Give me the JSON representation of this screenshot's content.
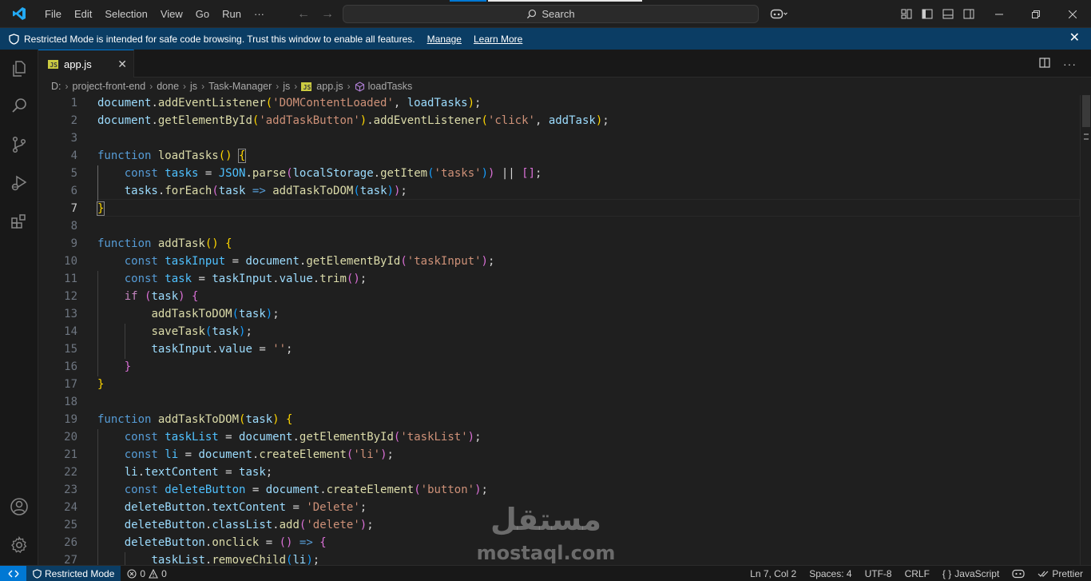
{
  "app": {
    "menu": [
      "File",
      "Edit",
      "Selection",
      "View",
      "Go",
      "Run",
      "···"
    ],
    "search_label": "Search",
    "accent_color": "#0078d4"
  },
  "banner": {
    "message": "Restricted Mode is intended for safe code browsing. Trust this window to enable all features.",
    "manage_label": "Manage",
    "learn_more_label": "Learn More"
  },
  "activity_icons": [
    "explorer-icon",
    "search-icon",
    "source-control-icon",
    "run-debug-icon",
    "extensions-icon",
    "accounts-icon",
    "manage-gear-icon"
  ],
  "editor": {
    "tab": {
      "label": "app.js",
      "badge": "JS"
    },
    "breadcrumb": [
      "D:",
      "project-front-end",
      "done",
      "js",
      "Task-Manager",
      "js",
      "app.js",
      "loadTasks"
    ],
    "active_line": 7,
    "lines": [
      [
        [
          "document",
          "vr"
        ],
        [
          ".",
          "op"
        ],
        [
          "addEventListener",
          "fn"
        ],
        [
          "(",
          "b1"
        ],
        [
          "'DOMContentLoaded'",
          "st"
        ],
        [
          ", ",
          "op"
        ],
        [
          "loadTasks",
          "vr"
        ],
        [
          ")",
          "b1"
        ],
        [
          ";",
          "op"
        ]
      ],
      [
        [
          "document",
          "vr"
        ],
        [
          ".",
          "op"
        ],
        [
          "getElementById",
          "fn"
        ],
        [
          "(",
          "b1"
        ],
        [
          "'addTaskButton'",
          "st"
        ],
        [
          ")",
          "b1"
        ],
        [
          ".",
          "op"
        ],
        [
          "addEventListener",
          "fn"
        ],
        [
          "(",
          "b1"
        ],
        [
          "'click'",
          "st"
        ],
        [
          ", ",
          "op"
        ],
        [
          "addTask",
          "vr"
        ],
        [
          ")",
          "b1"
        ],
        [
          ";",
          "op"
        ]
      ],
      [],
      [
        [
          "function ",
          "kw"
        ],
        [
          "loadTasks",
          "fn"
        ],
        [
          "()",
          "b1"
        ],
        [
          " ",
          "op"
        ],
        [
          "{",
          "b1 match"
        ]
      ],
      [
        [
          "    ",
          "op"
        ],
        [
          "const ",
          "kw"
        ],
        [
          "tasks",
          "cn"
        ],
        [
          " = ",
          "op"
        ],
        [
          "JSON",
          "cn"
        ],
        [
          ".",
          "op"
        ],
        [
          "parse",
          "fn"
        ],
        [
          "(",
          "b2"
        ],
        [
          "localStorage",
          "vr"
        ],
        [
          ".",
          "op"
        ],
        [
          "getItem",
          "fn"
        ],
        [
          "(",
          "b3"
        ],
        [
          "'tasks'",
          "st"
        ],
        [
          ")",
          "b3"
        ],
        [
          ")",
          "b2"
        ],
        [
          " || ",
          "op"
        ],
        [
          "[]",
          "b2"
        ],
        [
          ";",
          "op"
        ]
      ],
      [
        [
          "    ",
          "op"
        ],
        [
          "tasks",
          "vr"
        ],
        [
          ".",
          "op"
        ],
        [
          "forEach",
          "fn"
        ],
        [
          "(",
          "b2"
        ],
        [
          "task",
          "vr"
        ],
        [
          " => ",
          "kw"
        ],
        [
          "addTaskToDOM",
          "fn"
        ],
        [
          "(",
          "b3"
        ],
        [
          "task",
          "vr"
        ],
        [
          ")",
          "b3"
        ],
        [
          ")",
          "b2"
        ],
        [
          ";",
          "op"
        ]
      ],
      [
        [
          "}",
          "b1 match"
        ]
      ],
      [],
      [
        [
          "function ",
          "kw"
        ],
        [
          "addTask",
          "fn"
        ],
        [
          "()",
          "b1"
        ],
        [
          " ",
          "op"
        ],
        [
          "{",
          "b1"
        ]
      ],
      [
        [
          "    ",
          "op"
        ],
        [
          "const ",
          "kw"
        ],
        [
          "taskInput",
          "cn"
        ],
        [
          " = ",
          "op"
        ],
        [
          "document",
          "vr"
        ],
        [
          ".",
          "op"
        ],
        [
          "getElementById",
          "fn"
        ],
        [
          "(",
          "b2"
        ],
        [
          "'taskInput'",
          "st"
        ],
        [
          ")",
          "b2"
        ],
        [
          ";",
          "op"
        ]
      ],
      [
        [
          "    ",
          "op"
        ],
        [
          "const ",
          "kw"
        ],
        [
          "task",
          "cn"
        ],
        [
          " = ",
          "op"
        ],
        [
          "taskInput",
          "vr"
        ],
        [
          ".",
          "op"
        ],
        [
          "value",
          "vr"
        ],
        [
          ".",
          "op"
        ],
        [
          "trim",
          "fn"
        ],
        [
          "()",
          "b2"
        ],
        [
          ";",
          "op"
        ]
      ],
      [
        [
          "    ",
          "op"
        ],
        [
          "if ",
          "ct"
        ],
        [
          "(",
          "b2"
        ],
        [
          "task",
          "vr"
        ],
        [
          ")",
          "b2"
        ],
        [
          " ",
          "op"
        ],
        [
          "{",
          "b2"
        ]
      ],
      [
        [
          "        ",
          "op"
        ],
        [
          "addTaskToDOM",
          "fn"
        ],
        [
          "(",
          "b3"
        ],
        [
          "task",
          "vr"
        ],
        [
          ")",
          "b3"
        ],
        [
          ";",
          "op"
        ]
      ],
      [
        [
          "        ",
          "op"
        ],
        [
          "saveTask",
          "fn"
        ],
        [
          "(",
          "b3"
        ],
        [
          "task",
          "vr"
        ],
        [
          ")",
          "b3"
        ],
        [
          ";",
          "op"
        ]
      ],
      [
        [
          "        ",
          "op"
        ],
        [
          "taskInput",
          "vr"
        ],
        [
          ".",
          "op"
        ],
        [
          "value",
          "vr"
        ],
        [
          " = ",
          "op"
        ],
        [
          "''",
          "st"
        ],
        [
          ";",
          "op"
        ]
      ],
      [
        [
          "    ",
          "op"
        ],
        [
          "}",
          "b2"
        ]
      ],
      [
        [
          "}",
          "b1"
        ]
      ],
      [],
      [
        [
          "function ",
          "kw"
        ],
        [
          "addTaskToDOM",
          "fn"
        ],
        [
          "(",
          "b1"
        ],
        [
          "task",
          "vr"
        ],
        [
          ")",
          "b1"
        ],
        [
          " ",
          "op"
        ],
        [
          "{",
          "b1"
        ]
      ],
      [
        [
          "    ",
          "op"
        ],
        [
          "const ",
          "kw"
        ],
        [
          "taskList",
          "cn"
        ],
        [
          " = ",
          "op"
        ],
        [
          "document",
          "vr"
        ],
        [
          ".",
          "op"
        ],
        [
          "getElementById",
          "fn"
        ],
        [
          "(",
          "b2"
        ],
        [
          "'taskList'",
          "st"
        ],
        [
          ")",
          "b2"
        ],
        [
          ";",
          "op"
        ]
      ],
      [
        [
          "    ",
          "op"
        ],
        [
          "const ",
          "kw"
        ],
        [
          "li",
          "cn"
        ],
        [
          " = ",
          "op"
        ],
        [
          "document",
          "vr"
        ],
        [
          ".",
          "op"
        ],
        [
          "createElement",
          "fn"
        ],
        [
          "(",
          "b2"
        ],
        [
          "'li'",
          "st"
        ],
        [
          ")",
          "b2"
        ],
        [
          ";",
          "op"
        ]
      ],
      [
        [
          "    ",
          "op"
        ],
        [
          "li",
          "vr"
        ],
        [
          ".",
          "op"
        ],
        [
          "textContent",
          "vr"
        ],
        [
          " = ",
          "op"
        ],
        [
          "task",
          "vr"
        ],
        [
          ";",
          "op"
        ]
      ],
      [
        [
          "    ",
          "op"
        ],
        [
          "const ",
          "kw"
        ],
        [
          "deleteButton",
          "cn"
        ],
        [
          " = ",
          "op"
        ],
        [
          "document",
          "vr"
        ],
        [
          ".",
          "op"
        ],
        [
          "createElement",
          "fn"
        ],
        [
          "(",
          "b2"
        ],
        [
          "'button'",
          "st"
        ],
        [
          ")",
          "b2"
        ],
        [
          ";",
          "op"
        ]
      ],
      [
        [
          "    ",
          "op"
        ],
        [
          "deleteButton",
          "vr"
        ],
        [
          ".",
          "op"
        ],
        [
          "textContent",
          "vr"
        ],
        [
          " = ",
          "op"
        ],
        [
          "'Delete'",
          "st"
        ],
        [
          ";",
          "op"
        ]
      ],
      [
        [
          "    ",
          "op"
        ],
        [
          "deleteButton",
          "vr"
        ],
        [
          ".",
          "op"
        ],
        [
          "classList",
          "vr"
        ],
        [
          ".",
          "op"
        ],
        [
          "add",
          "fn"
        ],
        [
          "(",
          "b2"
        ],
        [
          "'delete'",
          "st"
        ],
        [
          ")",
          "b2"
        ],
        [
          ";",
          "op"
        ]
      ],
      [
        [
          "    ",
          "op"
        ],
        [
          "deleteButton",
          "vr"
        ],
        [
          ".",
          "op"
        ],
        [
          "onclick",
          "fn"
        ],
        [
          " = ",
          "op"
        ],
        [
          "()",
          "b2"
        ],
        [
          " => ",
          "kw"
        ],
        [
          "{",
          "b2"
        ]
      ],
      [
        [
          "        ",
          "op"
        ],
        [
          "taskList",
          "vr"
        ],
        [
          ".",
          "op"
        ],
        [
          "removeChild",
          "fn"
        ],
        [
          "(",
          "b3"
        ],
        [
          "li",
          "vr"
        ],
        [
          ")",
          "b3"
        ],
        [
          ";",
          "op"
        ]
      ]
    ]
  },
  "watermark": {
    "arabic": "مستقل",
    "latin": "mostaql.com"
  },
  "status": {
    "restricted_label": "Restricted Mode",
    "errors": "0",
    "warnings": "0",
    "cursor": "Ln 7, Col 2",
    "spaces": "Spaces: 4",
    "encoding": "UTF-8",
    "eol": "CRLF",
    "language": "JavaScript",
    "formatter": "Prettier"
  }
}
